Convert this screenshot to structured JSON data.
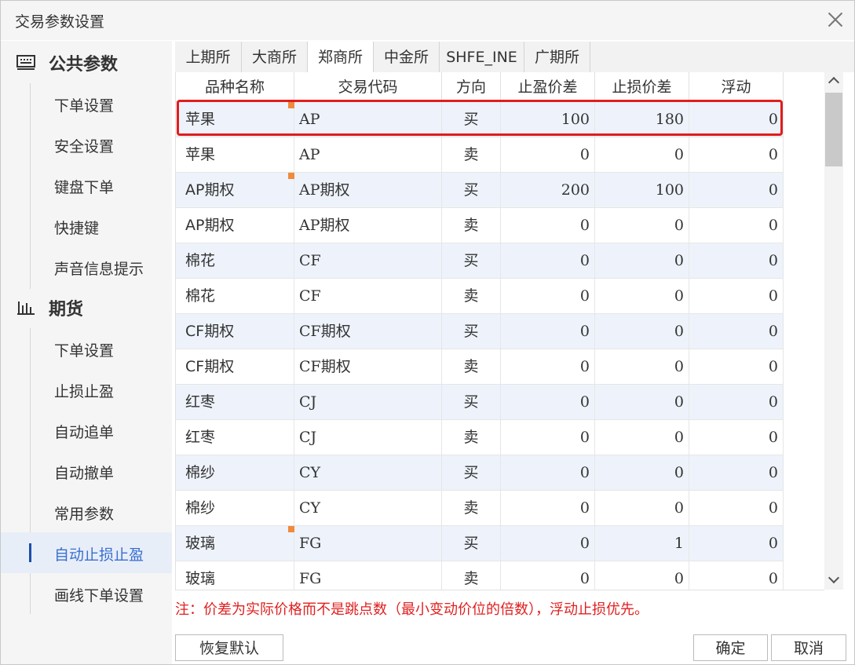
{
  "window": {
    "title": "交易参数设置"
  },
  "sidebar": {
    "sections": [
      {
        "label": "公共参数",
        "icon": "keyboard-icon",
        "items": [
          "下单设置",
          "安全设置",
          "键盘下单",
          "快捷键",
          "声音信息提示"
        ]
      },
      {
        "label": "期货",
        "icon": "bar-chart-icon",
        "items": [
          "下单设置",
          "止损止盈",
          "自动追单",
          "自动撤单",
          "常用参数",
          "自动止损止盈",
          "画线下单设置"
        ]
      }
    ],
    "active_item": "自动止损止盈"
  },
  "tabs": [
    "上期所",
    "大商所",
    "郑商所",
    "中金所",
    "SHFE_INE",
    "广期所"
  ],
  "active_tab": "郑商所",
  "table": {
    "columns": [
      "品种名称",
      "交易代码",
      "方向",
      "止盈价差",
      "止损价差",
      "浮动"
    ],
    "rows": [
      [
        "苹果",
        "AP",
        "买",
        "100",
        "180",
        "0"
      ],
      [
        "苹果",
        "AP",
        "卖",
        "0",
        "0",
        "0"
      ],
      [
        "AP期权",
        "AP期权",
        "买",
        "200",
        "100",
        "0"
      ],
      [
        "AP期权",
        "AP期权",
        "卖",
        "0",
        "0",
        "0"
      ],
      [
        "棉花",
        "CF",
        "买",
        "0",
        "0",
        "0"
      ],
      [
        "棉花",
        "CF",
        "卖",
        "0",
        "0",
        "0"
      ],
      [
        "CF期权",
        "CF期权",
        "买",
        "0",
        "0",
        "0"
      ],
      [
        "CF期权",
        "CF期权",
        "卖",
        "0",
        "0",
        "0"
      ],
      [
        "红枣",
        "CJ",
        "买",
        "0",
        "0",
        "0"
      ],
      [
        "红枣",
        "CJ",
        "卖",
        "0",
        "0",
        "0"
      ],
      [
        "棉纱",
        "CY",
        "买",
        "0",
        "0",
        "0"
      ],
      [
        "棉纱",
        "CY",
        "卖",
        "0",
        "0",
        "0"
      ],
      [
        "玻璃",
        "FG",
        "买",
        "0",
        "1",
        "0"
      ],
      [
        "玻璃",
        "FG",
        "卖",
        "0",
        "0",
        "0"
      ]
    ],
    "modified_row_flags": [
      0,
      2,
      12
    ],
    "highlighted_row": 0,
    "highlight_color": "#e11d1d",
    "flag_color": "#f08a3c"
  },
  "note": "注：价差为实际价格而不是跳点数（最小变动价位的倍数），浮动止损优先。",
  "buttons": {
    "reset": "恢复默认",
    "ok": "确定",
    "cancel": "取消"
  }
}
